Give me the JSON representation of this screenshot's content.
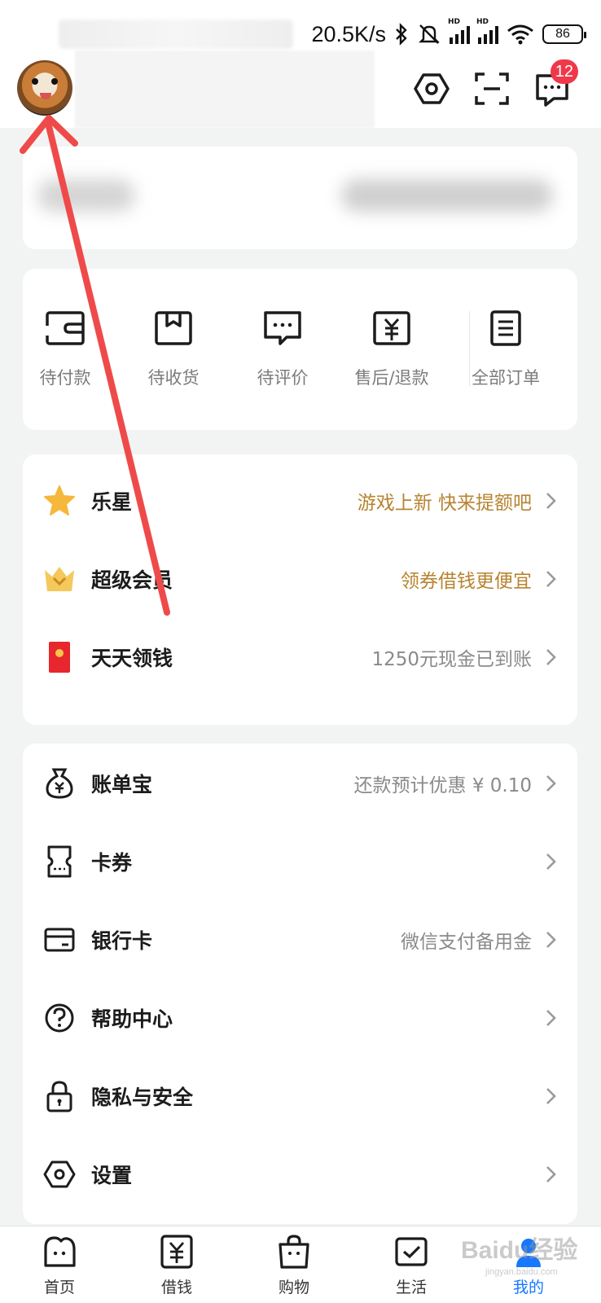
{
  "status_bar": {
    "net_speed": "20.5K/s",
    "battery": "86",
    "hd": "HD"
  },
  "header": {
    "message_badge": "12"
  },
  "orders": [
    {
      "label": "待付款",
      "icon": "wallet-icon"
    },
    {
      "label": "待收货",
      "icon": "box-icon"
    },
    {
      "label": "待评价",
      "icon": "comment-icon"
    },
    {
      "label": "售后/退款",
      "icon": "refund-icon"
    },
    {
      "label": "全部订单",
      "icon": "order-list-icon"
    }
  ],
  "promos": [
    {
      "label": "乐星",
      "value": "游戏上新 快来提额吧",
      "icon": "star-icon",
      "value_color": "#b78431"
    },
    {
      "label": "超级会员",
      "value": "领券借钱更便宜",
      "icon": "crown-icon",
      "value_color": "#b78431"
    },
    {
      "label": "天天领钱",
      "value": "1250元现金已到账",
      "icon": "red-envelope-icon",
      "value_color": "#8a8a8a"
    }
  ],
  "services": [
    {
      "label": "账单宝",
      "value": "还款预计优惠 ¥ 0.10",
      "icon": "money-bag-icon"
    },
    {
      "label": "卡券",
      "value": "",
      "icon": "coupon-icon"
    },
    {
      "label": "银行卡",
      "value": "微信支付备用金",
      "icon": "bank-card-icon"
    },
    {
      "label": "帮助中心",
      "value": "",
      "icon": "help-icon"
    },
    {
      "label": "隐私与安全",
      "value": "",
      "icon": "lock-icon"
    },
    {
      "label": "设置",
      "value": "",
      "icon": "settings-icon"
    }
  ],
  "bottom_nav": [
    {
      "label": "首页",
      "icon": "home-icon",
      "active": false
    },
    {
      "label": "借钱",
      "icon": "loan-icon",
      "active": false
    },
    {
      "label": "购物",
      "icon": "shopping-bag-icon",
      "active": false
    },
    {
      "label": "生活",
      "icon": "life-icon",
      "active": false
    },
    {
      "label": "我的",
      "icon": "profile-icon",
      "active": true
    }
  ],
  "colors": {
    "accent_blue": "#1677ff",
    "promo_gold": "#b78431",
    "badge_red": "#f0384a",
    "annotation_arrow": "#ef4a4a"
  },
  "watermark": {
    "text": "Baidu经验",
    "sub": "jingyan.baidu.com"
  }
}
